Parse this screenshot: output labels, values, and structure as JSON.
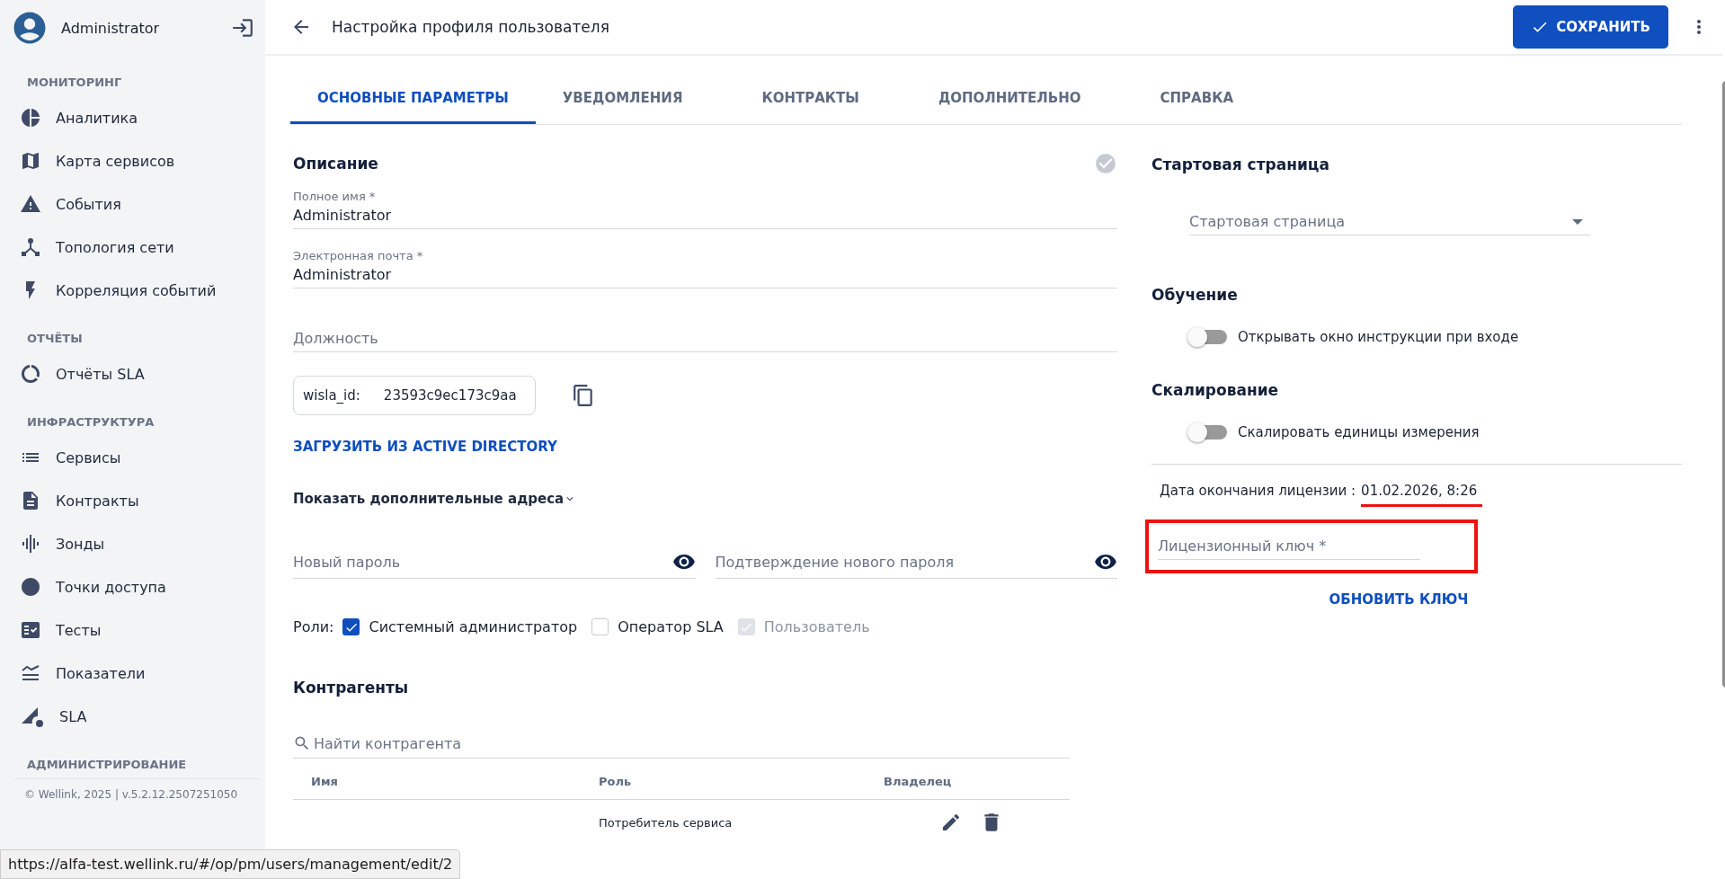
{
  "user": {
    "name": "Administrator"
  },
  "sidebar": {
    "sections": [
      {
        "title": "МОНИТОРИНГ",
        "items": [
          {
            "label": "Аналитика"
          },
          {
            "label": "Карта сервисов"
          },
          {
            "label": "События"
          },
          {
            "label": "Топология сети"
          },
          {
            "label": "Корреляция событий"
          }
        ]
      },
      {
        "title": "ОТЧЁТЫ",
        "items": [
          {
            "label": "Отчёты SLA"
          }
        ]
      },
      {
        "title": "ИНФРАСТРУКТУРА",
        "items": [
          {
            "label": "Сервисы"
          },
          {
            "label": "Контракты"
          },
          {
            "label": "Зонды"
          },
          {
            "label": "Точки доступа"
          },
          {
            "label": "Тесты"
          },
          {
            "label": "Показатели"
          },
          {
            "label": "SLA"
          }
        ]
      },
      {
        "title": "АДМИНИСТРИРОВАНИЕ"
      }
    ],
    "footer": "© Wellink, 2025 | v.5.2.12.2507251050"
  },
  "header": {
    "title": "Настройка профиля пользователя",
    "save_button": "СОХРАНИТЬ"
  },
  "tabs": [
    {
      "label": "ОСНОВНЫЕ ПАРАМЕТРЫ",
      "selected": true
    },
    {
      "label": "УВЕДОМЛЕНИЯ",
      "selected": false
    },
    {
      "label": "КОНТРАКТЫ",
      "selected": false
    },
    {
      "label": "ДОПОЛНИТЕЛЬНО",
      "selected": false
    },
    {
      "label": "СПРАВКА",
      "selected": false
    }
  ],
  "description": {
    "title": "Описание",
    "fields": [
      {
        "label": "Полное имя *",
        "value": "Administrator"
      },
      {
        "label": "Электронная почта *",
        "value": "Administrator"
      },
      {
        "placeholder": "Должность"
      }
    ],
    "wisla_id": {
      "label": "wisla_id:",
      "value": "23593c9ec173c9aa"
    },
    "ad_button": "ЗАГРУЗИТЬ ИЗ ACTIVE DIRECTORY",
    "extra_addresses": "Показать дополнительные адреса",
    "passwords": [
      {
        "placeholder": "Новый пароль"
      },
      {
        "placeholder": "Подтверждение нового пароля"
      }
    ],
    "roles_label": "Роли:",
    "roles": [
      {
        "label": "Системный администратор",
        "checked": true,
        "disabled": false
      },
      {
        "label": "Оператор SLA",
        "checked": false,
        "disabled": false
      },
      {
        "label": "Пользователь",
        "checked": true,
        "disabled": true
      }
    ]
  },
  "counterparties": {
    "title": "Контрагенты",
    "search_placeholder": "Найти контрагента",
    "columns": [
      "Имя",
      "Роль",
      "Владелец"
    ],
    "rows": [
      {
        "role": "Потребитель сервиса"
      }
    ]
  },
  "start_page": {
    "title": "Стартовая страница",
    "placeholder": "Стартовая страница"
  },
  "toggles": [
    {
      "title": "Обучение",
      "label": "Открывать окно инструкции при входе",
      "on": false
    },
    {
      "title": "Скалирование",
      "label": "Скалировать единицы измерения",
      "on": false
    }
  ],
  "license": {
    "label": "Дата окончания лицензии :",
    "date": "01.02.2026, 8:26",
    "underlined": true,
    "key_placeholder": "Лицензионный ключ *",
    "highlighted": true,
    "update_button": "ОБНОВИТЬ КЛЮЧ"
  },
  "status_url": "https://alfa-test.wellink.ru/#/op/pm/users/management/edit/2"
}
